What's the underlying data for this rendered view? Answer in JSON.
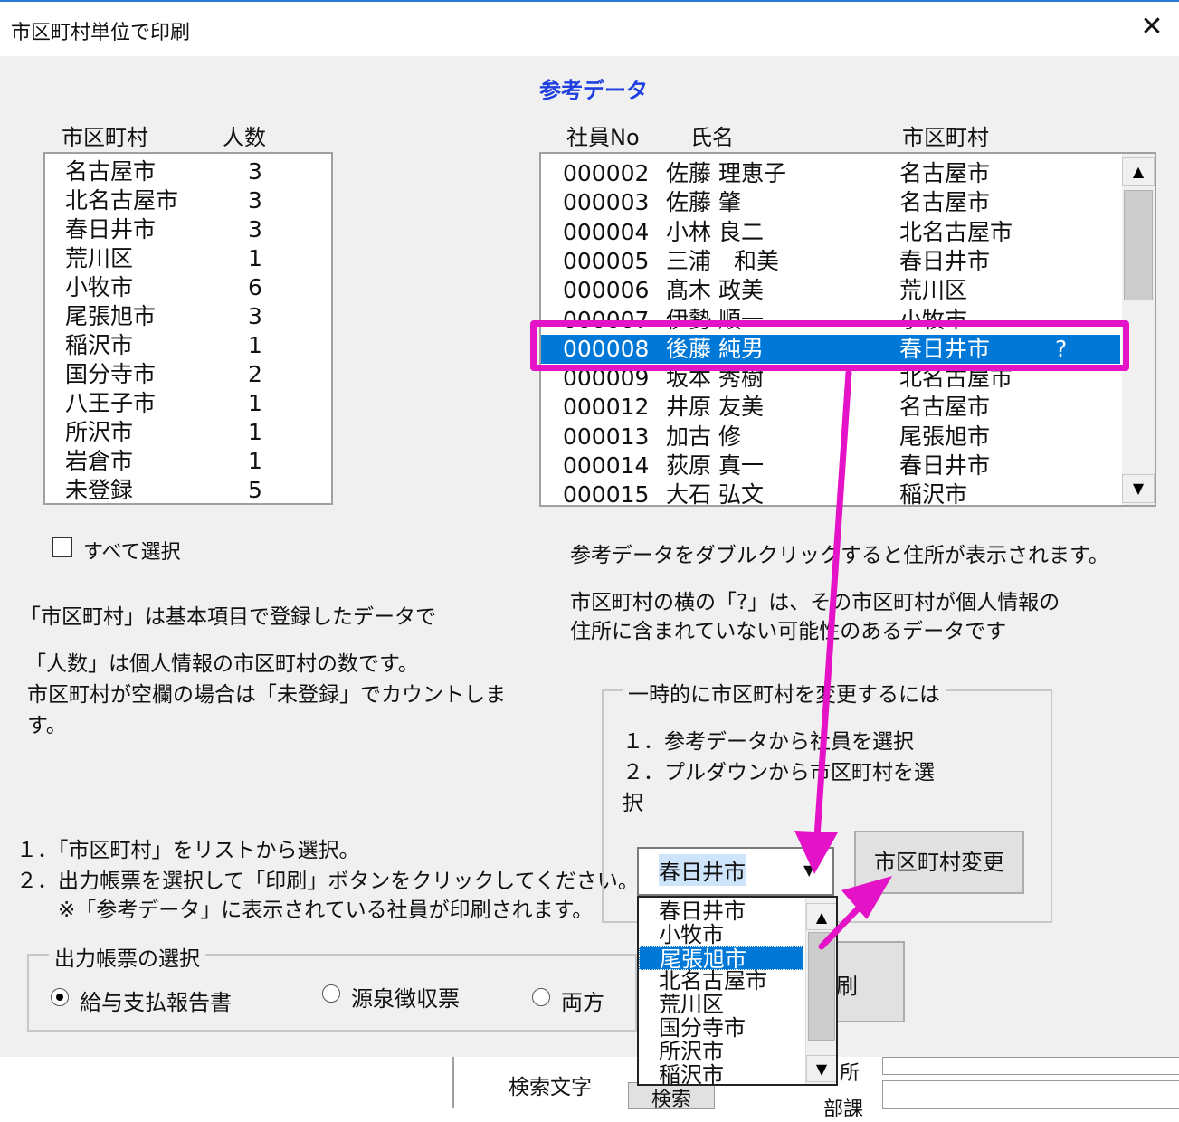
{
  "window": {
    "title": "市区町村単位で印刷",
    "close_glyph": "✕"
  },
  "reference": {
    "title": "参考データ",
    "headers": [
      "社員No",
      "氏名",
      "市区町村"
    ],
    "rows": [
      {
        "no": "000002",
        "name": "佐藤 理恵子",
        "city": "名古屋市",
        "flag": ""
      },
      {
        "no": "000003",
        "name": "佐藤 肇",
        "city": "名古屋市",
        "flag": ""
      },
      {
        "no": "000004",
        "name": "小林 良二",
        "city": "北名古屋市",
        "flag": ""
      },
      {
        "no": "000005",
        "name": "三浦　和美",
        "city": "春日井市",
        "flag": ""
      },
      {
        "no": "000006",
        "name": "髙木 政美",
        "city": "荒川区",
        "flag": ""
      },
      {
        "no": "000007",
        "name": "伊勢 順一",
        "city": "小牧市",
        "flag": ""
      },
      {
        "no": "000008",
        "name": "後藤 純男",
        "city": "春日井市",
        "flag": "?"
      },
      {
        "no": "000009",
        "name": "坂本 秀樹",
        "city": "北名古屋市",
        "flag": ""
      },
      {
        "no": "000012",
        "name": "井原 友美",
        "city": "名古屋市",
        "flag": ""
      },
      {
        "no": "000013",
        "name": "加古 修",
        "city": "尾張旭市",
        "flag": ""
      },
      {
        "no": "000014",
        "name": "荻原 真一",
        "city": "春日井市",
        "flag": ""
      },
      {
        "no": "000015",
        "name": "大石 弘文",
        "city": "稲沢市",
        "flag": ""
      }
    ],
    "selected_index": 6,
    "note1": "参考データをダブルクリックすると住所が表示されます。",
    "note2_line1": "市区町村の横の「?」は、その市区町村が個人情報の",
    "note2_line2": "住所に含まれていない可能性のあるデータです"
  },
  "city_list": {
    "headers": [
      "市区町村",
      "人数"
    ],
    "rows": [
      {
        "city": "名古屋市",
        "count": "3"
      },
      {
        "city": "北名古屋市",
        "count": "3"
      },
      {
        "city": "春日井市",
        "count": "3"
      },
      {
        "city": "荒川区",
        "count": "1"
      },
      {
        "city": "小牧市",
        "count": "6"
      },
      {
        "city": "尾張旭市",
        "count": "3"
      },
      {
        "city": "稲沢市",
        "count": "1"
      },
      {
        "city": "国分寺市",
        "count": "2"
      },
      {
        "city": "八王子市",
        "count": "1"
      },
      {
        "city": "所沢市",
        "count": "1"
      },
      {
        "city": "岩倉市",
        "count": "1"
      },
      {
        "city": "未登録",
        "count": "5"
      }
    ],
    "select_all_label": "すべて選択",
    "select_all_checked": false
  },
  "explanations": {
    "line1": "「市区町村」は基本項目で登録したデータで",
    "line2": "「人数」は個人情報の市区町村の数です。",
    "line3": "市区町村が空欄の場合は「未登録」でカウントしま",
    "line4": "す。"
  },
  "steps": {
    "s1": "１．「市区町村」をリストから選択。",
    "s2": "２．出力帳票を選択して「印刷」ボタンをクリックしてください。",
    "s3": "※「参考データ」に表示されている社員が印刷されます。"
  },
  "temp_change": {
    "group_label": "一時的に市区町村を変更するには",
    "step1": "１．参考データから社員を選択",
    "step2a": "２．プルダウンから市区町村を選",
    "step2b": "択",
    "combo_value": "春日井市",
    "change_button": "市区町村変更",
    "dropdown_options": [
      "春日井市",
      "小牧市",
      "尾張旭市",
      "北名古屋市",
      "荒川区",
      "国分寺市",
      "所沢市",
      "稲沢市"
    ],
    "dropdown_selected_index": 2
  },
  "output": {
    "group_label": "出力帳票の選択",
    "options": [
      "給与支払報告書",
      "源泉徴収票",
      "両方"
    ],
    "selected_index": 0,
    "print_button_partial": "刷"
  },
  "background_window": {
    "search_label": "検索文字",
    "search_button_partial": "検索",
    "label_dept_partial": "部課",
    "label_addr_partial": "所"
  },
  "colors": {
    "accent_blue": "#0078d7",
    "title_blue": "#1f3fe0",
    "annotation_magenta": "#e413c7"
  }
}
